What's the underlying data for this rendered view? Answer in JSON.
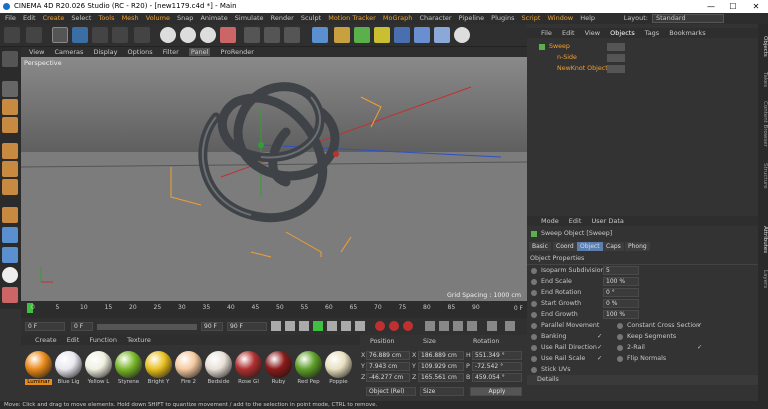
{
  "window": {
    "title": "CINEMA 4D R20.026 Studio (RC - R20) - [new1179.c4d *] - Main",
    "minimize": "—",
    "maximize": "☐",
    "close": "✕"
  },
  "menu": {
    "items": [
      "File",
      "Edit",
      "Create",
      "Select",
      "Tools",
      "Mesh",
      "Volume",
      "Snap",
      "Animate",
      "Simulate",
      "Render",
      "Sculpt",
      "Motion Tracker",
      "MoGraph",
      "Character",
      "Pipeline",
      "Plugins",
      "Script",
      "Window",
      "Help"
    ],
    "layout_label": "Layout:",
    "layout_value": "Standard"
  },
  "viewport": {
    "menu": [
      "View",
      "Cameras",
      "Display",
      "Options",
      "Filter",
      "Panel",
      "ProRender"
    ],
    "camera": "Perspective",
    "grid_spacing": "Grid Spacing : 1000 cm"
  },
  "timeline": {
    "ticks": [
      "0",
      "5",
      "10",
      "15",
      "20",
      "25",
      "30",
      "35",
      "40",
      "45",
      "50",
      "55",
      "60",
      "65",
      "70",
      "75",
      "80",
      "85",
      "90"
    ],
    "end_frame": "0 F"
  },
  "transport": {
    "current": "0 F",
    "start": "0 F",
    "end": "90 F",
    "end2": "90 F"
  },
  "materials": {
    "menu": [
      "Create",
      "Edit",
      "Function",
      "Texture"
    ],
    "items": [
      {
        "name": "Luminar",
        "color": "#e98a1a"
      },
      {
        "name": "Blue Lig",
        "color": "#e8e8f0"
      },
      {
        "name": "Yellow L",
        "color": "#f0f0e0"
      },
      {
        "name": "Styrene",
        "color": "#7ab82a"
      },
      {
        "name": "Bright Y",
        "color": "#e8c020"
      },
      {
        "name": "Fire 2",
        "color": "#f4c9a0"
      },
      {
        "name": "Bedside",
        "color": "#e8e0d8"
      },
      {
        "name": "Rose Gl",
        "color": "#b03030"
      },
      {
        "name": "Ruby",
        "color": "#8a1a1a"
      },
      {
        "name": "Red Pep",
        "color": "#5fa02a"
      },
      {
        "name": "Poppie",
        "color": "#e8e0c0"
      }
    ]
  },
  "coords": {
    "headers": [
      "Position",
      "Size",
      "Rotation"
    ],
    "rows": [
      {
        "axis": "X",
        "pos": "76.889 cm",
        "size": "186.889 cm",
        "rot_axis": "H",
        "rot": "551.349 °"
      },
      {
        "axis": "Y",
        "pos": "7.943 cm",
        "size": "109.929 cm",
        "rot_axis": "P",
        "rot": "-72.542 °"
      },
      {
        "axis": "Z",
        "pos": "-46.277 cm",
        "size": "165.561 cm",
        "rot_axis": "B",
        "rot": "459.054 °"
      }
    ],
    "mode": "Object (Rel)",
    "size_mode": "Size",
    "apply": "Apply"
  },
  "objects": {
    "menu": [
      "File",
      "Edit",
      "View",
      "Objects",
      "Tags",
      "Bookmarks"
    ],
    "tree": [
      {
        "name": "Sweep",
        "color": "#f0a030"
      },
      {
        "name": "n-Side",
        "color": "#f0a030"
      },
      {
        "name": "NewKnot Object",
        "color": "#f0a030"
      }
    ]
  },
  "attributes": {
    "menu": [
      "Mode",
      "Edit",
      "User Data"
    ],
    "object_title": "Sweep Object [Sweep]",
    "tabs": [
      "Basic",
      "Coord",
      "Object",
      "Caps",
      "Phong"
    ],
    "section": "Object Properties",
    "fields": [
      {
        "label": "Isoparm Subdivision",
        "value": "5"
      },
      {
        "label": "End Scale",
        "value": "100 %"
      },
      {
        "label": "End Rotation",
        "value": "0 °"
      },
      {
        "label": "Start Growth",
        "value": "0 %"
      },
      {
        "label": "End Growth",
        "value": "100 %"
      }
    ],
    "checks_left": [
      {
        "label": "Parallel Movement",
        "value": ""
      },
      {
        "label": "Banking",
        "value": "✓"
      },
      {
        "label": "Use Rail Direction",
        "value": "✓"
      },
      {
        "label": "Use Rail Scale",
        "value": "✓"
      },
      {
        "label": "Stick UVs",
        "value": ""
      }
    ],
    "checks_right": [
      {
        "label": "Constant Cross Section",
        "value": "✓"
      },
      {
        "label": "Keep Segments",
        "value": ""
      },
      {
        "label": "2-Rail",
        "value": "✓"
      },
      {
        "label": "Flip Normals",
        "value": ""
      }
    ],
    "details": "Details"
  },
  "right_tabs": [
    "Objects",
    "Takes",
    "Content Browser",
    "Structure",
    "Attributes",
    "Layers"
  ],
  "status": "Move: Click and drag to move elements. Hold down SHIFT to quantize movement / add to the selection in point mode, CTRL to remove."
}
